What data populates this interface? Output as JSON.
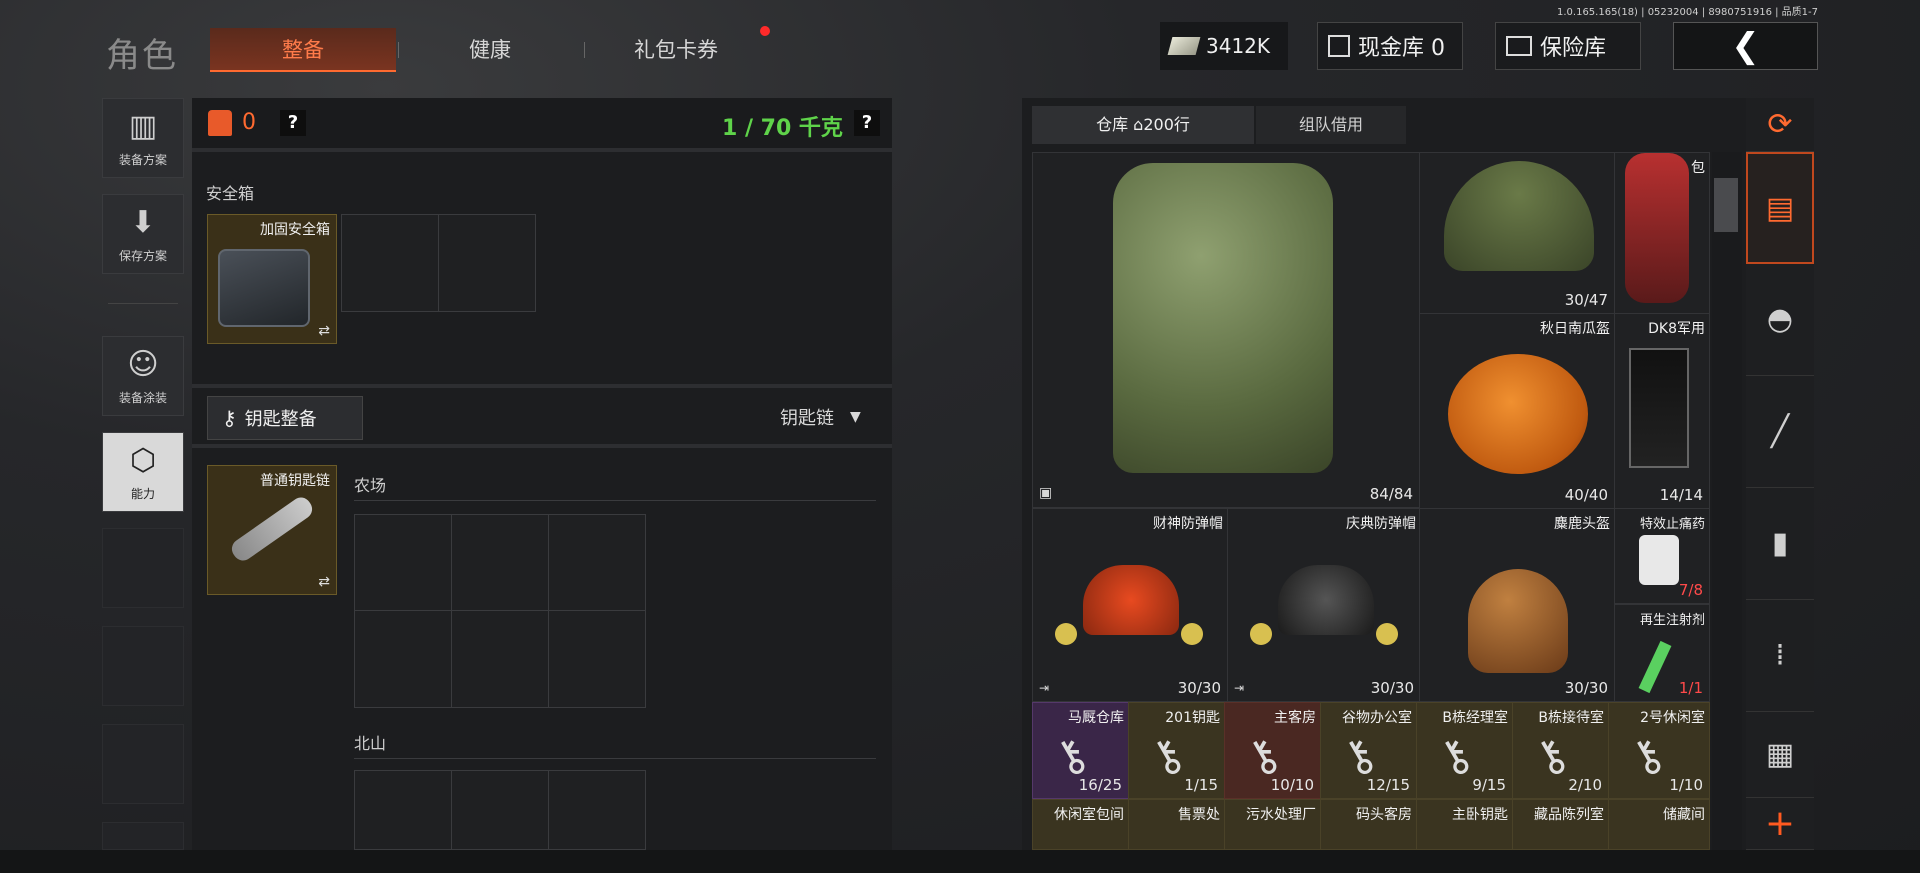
{
  "version": "1.0.165.165(18) | 05232004 | 8980751916 | 品质1-7",
  "header": {
    "title": "角色",
    "tabs": [
      {
        "label": "整备",
        "active": true
      },
      {
        "label": "健康",
        "active": false
      },
      {
        "label": "礼包卡券",
        "active": false
      }
    ],
    "money": "3412K",
    "cash_vault": "现金库 0",
    "insurance": "保险库",
    "back_icon": "chevron-left-icon"
  },
  "sidebar": [
    {
      "label": "装备方案",
      "icon": "vest-icon"
    },
    {
      "label": "保存方案",
      "icon": "download-icon"
    },
    {
      "label": "装备涂装",
      "icon": "soldier-icon"
    },
    {
      "label": "能力",
      "icon": "ability-icon",
      "active": true
    }
  ],
  "loadout": {
    "armor_count": "0",
    "weight": "1 / 70 千克",
    "safe_box_label": "安全箱",
    "safe_box_item": "加固安全箱",
    "key_gear_label": "钥匙整备",
    "key_chain_select": "钥匙链",
    "key_chain_item": "普通钥匙链",
    "map_farm": "农场",
    "map_north": "北山"
  },
  "warehouse": {
    "tabs": [
      {
        "label": "仓库 ⌂200行",
        "active": true
      },
      {
        "label": "组队借用",
        "active": false
      }
    ],
    "items": [
      {
        "name": "",
        "count": "84/84"
      },
      {
        "name": "",
        "count": "30/47"
      },
      {
        "name": "包",
        "count": ""
      },
      {
        "name": "秋日南瓜盔",
        "count": "40/40"
      },
      {
        "name": "DK8军用",
        "count": "14/14"
      },
      {
        "name": "财神防弹帽",
        "count": "30/30"
      },
      {
        "name": "庆典防弹帽",
        "count": "30/30"
      },
      {
        "name": "麋鹿头盔",
        "count": "30/30"
      },
      {
        "name": "特效止痛药",
        "count": "7/8"
      },
      {
        "name": "再生注射剂",
        "count": "1/1"
      }
    ],
    "keys": [
      {
        "name": "马厩仓库",
        "count": "16/25"
      },
      {
        "name": "201钥匙",
        "count": "1/15"
      },
      {
        "name": "主客房",
        "count": "10/10"
      },
      {
        "name": "谷物办公室",
        "count": "12/15"
      },
      {
        "name": "B栋经理室",
        "count": "9/15"
      },
      {
        "name": "B栋接待室",
        "count": "2/10"
      },
      {
        "name": "2号休闲室",
        "count": "1/10"
      }
    ],
    "keys_row2": [
      {
        "name": "休闲室包间"
      },
      {
        "name": "售票处"
      },
      {
        "name": "污水处理厂"
      },
      {
        "name": "码头客房"
      },
      {
        "name": "主卧钥匙"
      },
      {
        "name": "藏品陈列室"
      },
      {
        "name": "储藏间"
      }
    ]
  },
  "filter_icons": [
    "refresh-icon",
    "layers-icon",
    "helmet-icon",
    "rifle-icon",
    "magazine-icon",
    "ammo-icon",
    "medkit-icon",
    "plus-icon"
  ]
}
